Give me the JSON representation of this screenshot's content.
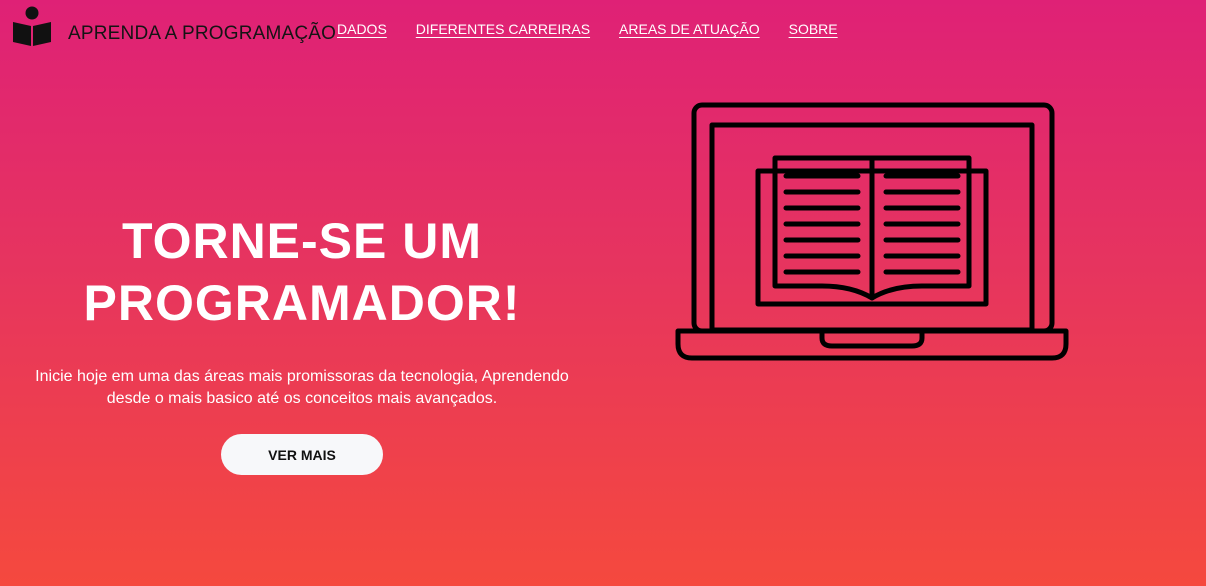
{
  "header": {
    "logo_icon": "reading-person-icon",
    "brand": "APRENDA A PROGRAMAÇÃO",
    "nav": [
      {
        "label": "DADOS"
      },
      {
        "label": "DIFERENTES CARREIRAS"
      },
      {
        "label": "AREAS DE ATUAÇÃO"
      },
      {
        "label": "SOBRE"
      }
    ]
  },
  "hero": {
    "title_line1": "TORNE-SE UM",
    "title_line2": "PROGRAMADOR!",
    "subtitle_line1": "Inicie hoje em uma das áreas mais promissoras da tecnologia, Aprendendo",
    "subtitle_line2": "desde o mais basico até os conceitos mais avançados.",
    "cta_label": "VER MAIS",
    "illustration_icon": "laptop-book-icon"
  },
  "colors": {
    "gradient_top": "#df2176",
    "gradient_bottom": "#f5493e",
    "button_bg": "#f7f8fa"
  }
}
